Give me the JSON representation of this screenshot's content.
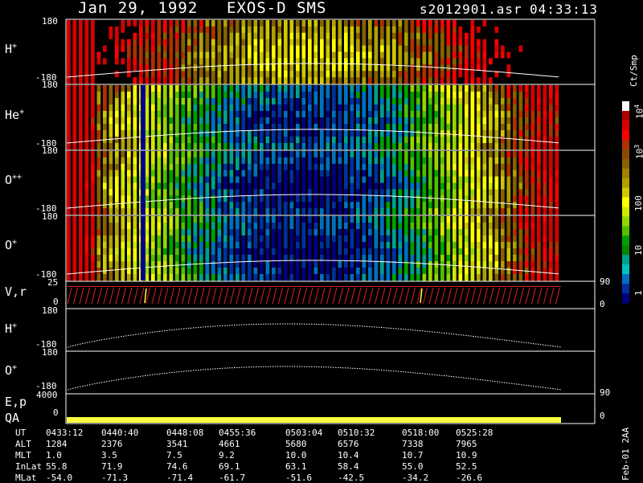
{
  "header": {
    "date": "Jan 29, 1992",
    "instrument": "EXOS-D SMS",
    "file": "s2012901.asr",
    "time": "04:33:13"
  },
  "panels": {
    "h_plus": {
      "ion": "H",
      "charge": "+",
      "y_top": "180",
      "y_bottom": "-180"
    },
    "he_plus": {
      "ion": "He",
      "charge": "+",
      "y_top": "180",
      "y_bottom": "-180"
    },
    "o_pp": {
      "ion": "O",
      "charge": "++",
      "y_top": "180",
      "y_bottom": "-180"
    },
    "o_plus": {
      "ion": "O",
      "charge": "+",
      "y_top": "180",
      "y_bottom": "-180"
    },
    "vr": {
      "label": "V,r",
      "y_top": "25",
      "y_bottom": "0",
      "right_top": "90",
      "right_bottom": "0"
    },
    "h_line": {
      "ion": "H",
      "charge": "+",
      "y_top": "180",
      "y_bottom": "-180"
    },
    "o_line": {
      "ion": "O",
      "charge": "+",
      "y_top": "180",
      "y_bottom": "-180"
    },
    "ep": {
      "label": "E,p",
      "y_top": "4000",
      "right_top": "90"
    },
    "qa": {
      "label": "QA",
      "y_bottom": "0",
      "right_bottom": "0"
    }
  },
  "colorbar": {
    "unit": "Ct/Smp",
    "tick_1e4": "10",
    "tick_1e4_exp": "4",
    "tick_1e3": "10",
    "tick_1e3_exp": "3",
    "tick_100": "100",
    "tick_10": "10",
    "tick_1": "1",
    "colors": [
      "#ffffff",
      "#b00000",
      "#d80000",
      "#ff0000",
      "#b03000",
      "#904800",
      "#886000",
      "#a08000",
      "#b0a000",
      "#d0c800",
      "#ffff00",
      "#d0e800",
      "#90d800",
      "#50c000",
      "#00a000",
      "#008800",
      "#00a090",
      "#00c0c0",
      "#0070c0",
      "#0030a0",
      "#000080"
    ]
  },
  "footer": {
    "rows": [
      {
        "label": "UT",
        "values": [
          "0433:12",
          "0440:40",
          "0448:08",
          "0455:36",
          "0503:04",
          "0510:32",
          "0518:00",
          "0525:28"
        ]
      },
      {
        "label": "ALT",
        "values": [
          "1284",
          "2376",
          "3541",
          "4661",
          "5680",
          "6576",
          "7338",
          "7965"
        ]
      },
      {
        "label": "MLT",
        "values": [
          "1.0",
          "3.5",
          "7.5",
          "9.2",
          "10.0",
          "10.4",
          "10.7",
          "10.9"
        ]
      },
      {
        "label": "InLat",
        "values": [
          "55.8",
          "71.9",
          "74.6",
          "69.1",
          "63.1",
          "58.4",
          "55.0",
          "52.5"
        ]
      },
      {
        "label": "MLat",
        "values": [
          "-54.0",
          "-71.3",
          "-71.4",
          "-61.7",
          "-51.6",
          "-42.5",
          "-34.2",
          "-26.6"
        ]
      }
    ],
    "stamp": "Feb-01 2AA"
  }
}
